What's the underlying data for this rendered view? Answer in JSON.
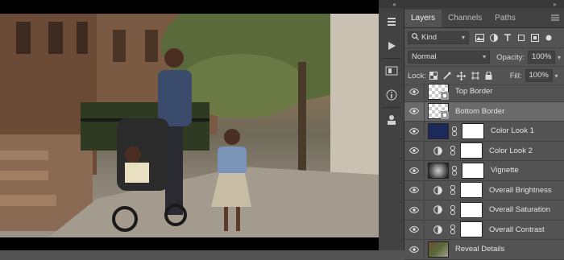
{
  "panel": {
    "tabs": [
      {
        "label": "Layers"
      },
      {
        "label": "Channels"
      },
      {
        "label": "Paths"
      }
    ],
    "filter_kind": "Kind",
    "blend_mode": "Normal",
    "opacity_label": "Opacity:",
    "opacity_value": "100%",
    "lock_label": "Lock:",
    "fill_label": "Fill:",
    "fill_value": "100%"
  },
  "layers": [
    {
      "name": "Top Border",
      "thumb": "checker"
    },
    {
      "name": "Bottom Border",
      "thumb": "checker",
      "selected": true
    },
    {
      "name": "Color Look 1",
      "thumb": "solid",
      "color": "#1b2a5a"
    },
    {
      "name": "Color Look 2",
      "thumb": "adjustment"
    },
    {
      "name": "Vignette",
      "thumb": "gradient"
    },
    {
      "name": "Overall Brightness",
      "thumb": "adjustment"
    },
    {
      "name": "Overall Saturation",
      "thumb": "adjustment"
    },
    {
      "name": "Overall Contrast",
      "thumb": "adjustment"
    },
    {
      "name": "Reveal Details",
      "thumb": "photo"
    }
  ],
  "colors": {
    "panel_bg": "#535353",
    "selected_row": "#6a6a6a",
    "tab_bar": "#424242"
  }
}
